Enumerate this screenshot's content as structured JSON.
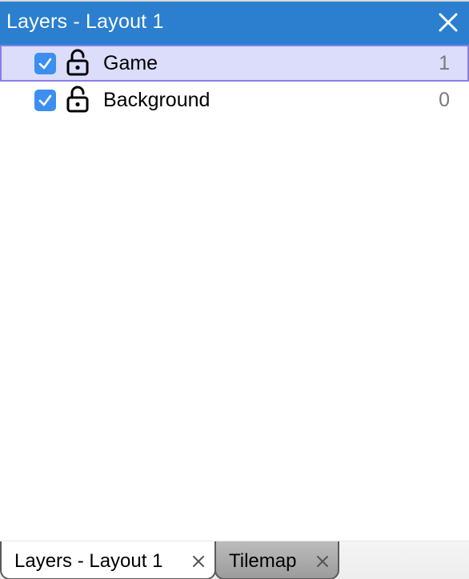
{
  "panel": {
    "title": "Layers - Layout 1",
    "close_icon": "close-icon"
  },
  "layers": [
    {
      "name": "Game",
      "index": "1",
      "visible": true,
      "locked": false,
      "selected": true
    },
    {
      "name": "Background",
      "index": "0",
      "visible": true,
      "locked": false,
      "selected": false
    }
  ],
  "tabs": [
    {
      "label": "Layers - Layout 1",
      "active": true
    },
    {
      "label": "Tilemap",
      "active": false
    }
  ],
  "colors": {
    "titlebar": "#2b7fce",
    "selection_bg": "#dcdcfb",
    "selection_border": "#8580e8",
    "checkbox": "#3d8fef"
  }
}
